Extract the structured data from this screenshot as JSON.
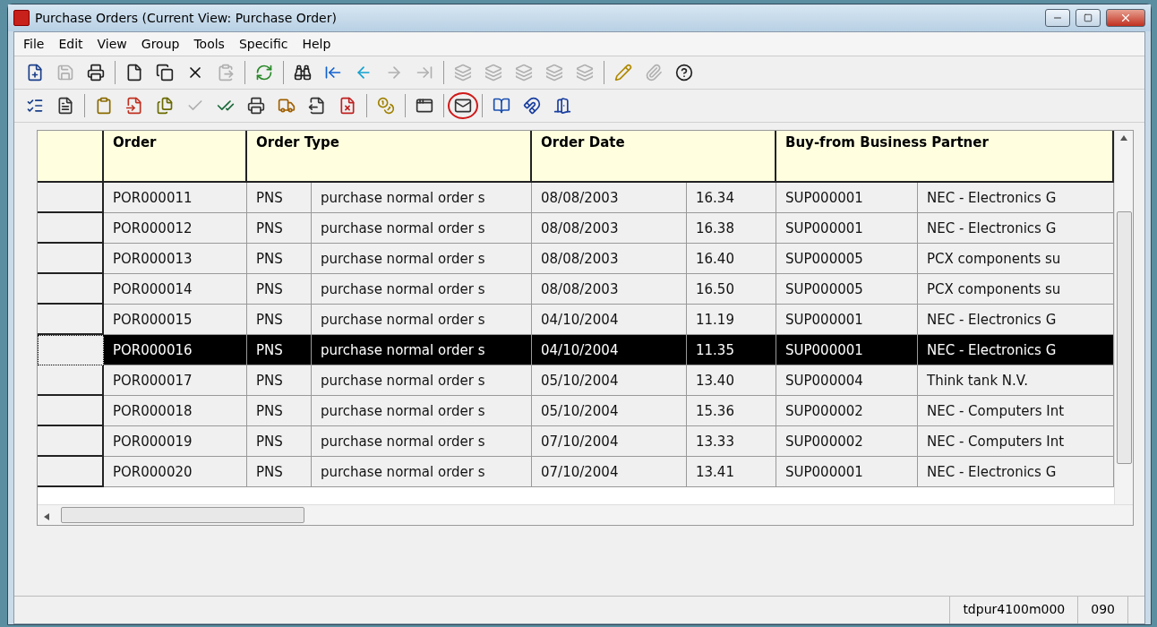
{
  "window": {
    "title": "Purchase Orders (Current View: Purchase Order)"
  },
  "menu": [
    "File",
    "Edit",
    "View",
    "Group",
    "Tools",
    "Specific",
    "Help"
  ],
  "toolbars": [
    [
      {
        "kind": "button",
        "disabled": false
      },
      {
        "kind": "button",
        "disabled": true
      },
      {
        "kind": "button",
        "disabled": false
      },
      {
        "kind": "separator"
      },
      {
        "kind": "button",
        "disabled": false
      },
      {
        "kind": "button",
        "disabled": false
      },
      {
        "kind": "button",
        "disabled": false
      },
      {
        "kind": "button",
        "disabled": true
      },
      {
        "kind": "separator"
      },
      {
        "kind": "button",
        "disabled": false
      },
      {
        "kind": "separator"
      },
      {
        "kind": "button",
        "disabled": false
      },
      {
        "kind": "button",
        "disabled": false
      },
      {
        "kind": "button",
        "disabled": false
      },
      {
        "kind": "button",
        "disabled": true
      },
      {
        "kind": "button",
        "disabled": true
      },
      {
        "kind": "separator"
      },
      {
        "kind": "button",
        "disabled": true
      },
      {
        "kind": "button",
        "disabled": true
      },
      {
        "kind": "button",
        "disabled": true
      },
      {
        "kind": "button",
        "disabled": true
      },
      {
        "kind": "button",
        "disabled": true
      },
      {
        "kind": "separator"
      },
      {
        "kind": "button",
        "disabled": false
      },
      {
        "kind": "button",
        "disabled": true
      },
      {
        "kind": "button",
        "disabled": false
      }
    ],
    [
      {
        "kind": "button",
        "disabled": false
      },
      {
        "kind": "button",
        "disabled": false
      },
      {
        "kind": "separator"
      },
      {
        "kind": "button",
        "disabled": false
      },
      {
        "kind": "button",
        "disabled": false
      },
      {
        "kind": "button",
        "disabled": false
      },
      {
        "kind": "button",
        "disabled": true
      },
      {
        "kind": "button",
        "disabled": false
      },
      {
        "kind": "button",
        "disabled": false
      },
      {
        "kind": "button",
        "disabled": false
      },
      {
        "kind": "button",
        "disabled": false
      },
      {
        "kind": "button",
        "disabled": false
      },
      {
        "kind": "separator"
      },
      {
        "kind": "button",
        "disabled": false
      },
      {
        "kind": "separator"
      },
      {
        "kind": "button",
        "disabled": false
      },
      {
        "kind": "separator"
      },
      {
        "kind": "button",
        "disabled": false,
        "highlighted": true
      },
      {
        "kind": "separator"
      },
      {
        "kind": "button",
        "disabled": false
      },
      {
        "kind": "button",
        "disabled": false
      },
      {
        "kind": "button",
        "disabled": false
      }
    ]
  ],
  "table": {
    "columns": [
      "Order",
      "Order Type",
      "Order Date",
      "Buy-from Business Partner"
    ],
    "rows": [
      {
        "selected": false,
        "order": "POR000011",
        "order_type": [
          "PNS",
          "purchase normal order s"
        ],
        "order_date": [
          "08/08/2003",
          "16.34"
        ],
        "buy_from_business_partner": [
          "SUP000001",
          "NEC - Electronics G"
        ]
      },
      {
        "selected": false,
        "order": "POR000012",
        "order_type": [
          "PNS",
          "purchase normal order s"
        ],
        "order_date": [
          "08/08/2003",
          "16.38"
        ],
        "buy_from_business_partner": [
          "SUP000001",
          "NEC - Electronics G"
        ]
      },
      {
        "selected": false,
        "order": "POR000013",
        "order_type": [
          "PNS",
          "purchase normal order s"
        ],
        "order_date": [
          "08/08/2003",
          "16.40"
        ],
        "buy_from_business_partner": [
          "SUP000005",
          "PCX components su"
        ]
      },
      {
        "selected": false,
        "order": "POR000014",
        "order_type": [
          "PNS",
          "purchase normal order s"
        ],
        "order_date": [
          "08/08/2003",
          "16.50"
        ],
        "buy_from_business_partner": [
          "SUP000005",
          "PCX components su"
        ]
      },
      {
        "selected": false,
        "order": "POR000015",
        "order_type": [
          "PNS",
          "purchase normal order s"
        ],
        "order_date": [
          "04/10/2004",
          "11.19"
        ],
        "buy_from_business_partner": [
          "SUP000001",
          "NEC - Electronics G"
        ]
      },
      {
        "selected": true,
        "order": "POR000016",
        "order_type": [
          "PNS",
          "purchase normal order s"
        ],
        "order_date": [
          "04/10/2004",
          "11.35"
        ],
        "buy_from_business_partner": [
          "SUP000001",
          "NEC - Electronics G"
        ]
      },
      {
        "selected": false,
        "order": "POR000017",
        "order_type": [
          "PNS",
          "purchase normal order s"
        ],
        "order_date": [
          "05/10/2004",
          "13.40"
        ],
        "buy_from_business_partner": [
          "SUP000004",
          "Think tank N.V."
        ]
      },
      {
        "selected": false,
        "order": "POR000018",
        "order_type": [
          "PNS",
          "purchase normal order s"
        ],
        "order_date": [
          "05/10/2004",
          "15.36"
        ],
        "buy_from_business_partner": [
          "SUP000002",
          "NEC - Computers Int"
        ]
      },
      {
        "selected": false,
        "order": "POR000019",
        "order_type": [
          "PNS",
          "purchase normal order s"
        ],
        "order_date": [
          "07/10/2004",
          "13.33"
        ],
        "buy_from_business_partner": [
          "SUP000002",
          "NEC - Computers Int"
        ]
      },
      {
        "selected": false,
        "order": "POR000020",
        "order_type": [
          "PNS",
          "purchase normal order s"
        ],
        "order_date": [
          "07/10/2004",
          "13.41"
        ],
        "buy_from_business_partner": [
          "SUP000001",
          "NEC - Electronics G"
        ]
      }
    ]
  },
  "status_bar": [
    "tdpur4100m000",
    "090"
  ]
}
